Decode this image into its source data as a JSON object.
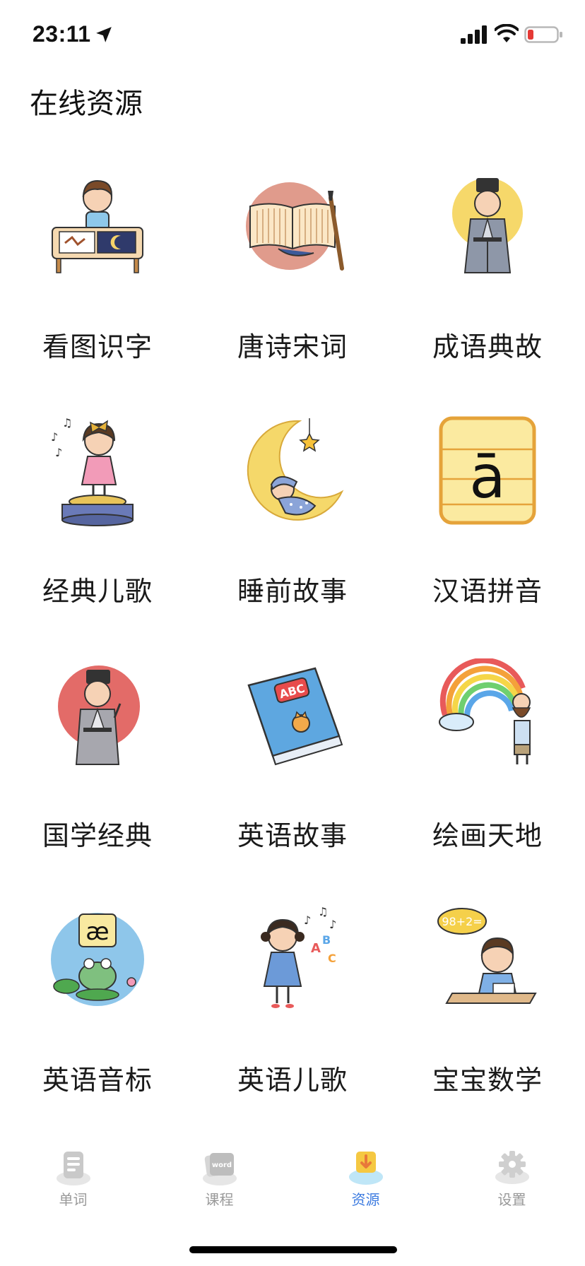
{
  "status_bar": {
    "time": "23:11",
    "icons": [
      "location-arrow-icon",
      "cellular-signal-icon",
      "wifi-icon",
      "battery-low-icon"
    ],
    "battery_color": "#e53935"
  },
  "page": {
    "title": "在线资源"
  },
  "resources": [
    {
      "label": "看图识字",
      "icon": "boy-writing-icon"
    },
    {
      "label": "唐诗宋词",
      "icon": "poetry-scroll-icon"
    },
    {
      "label": "成语典故",
      "icon": "scholar-icon"
    },
    {
      "label": "经典儿歌",
      "icon": "girl-singing-icon"
    },
    {
      "label": "睡前故事",
      "icon": "moon-baby-icon"
    },
    {
      "label": "汉语拼音",
      "icon": "pinyin-card-icon"
    },
    {
      "label": "国学经典",
      "icon": "confucian-scholar-icon"
    },
    {
      "label": "英语故事",
      "icon": "abc-book-icon"
    },
    {
      "label": "绘画天地",
      "icon": "rainbow-painter-icon"
    },
    {
      "label": "英语音标",
      "icon": "frog-phonetic-icon"
    },
    {
      "label": "英语儿歌",
      "icon": "girl-singing-abc-icon"
    },
    {
      "label": "宝宝数学",
      "icon": "boy-math-icon"
    }
  ],
  "pinyin_glyph": "ā",
  "phonetic_glyph": "æ",
  "book_text": "ABC",
  "math_text": "98+2=",
  "tab_bar": {
    "tabs": [
      {
        "label": "单词",
        "icon": "word-list-icon",
        "active": false
      },
      {
        "label": "课程",
        "icon": "word-cards-icon",
        "active": false,
        "icon_text": "word"
      },
      {
        "label": "资源",
        "icon": "cloud-download-icon",
        "active": true
      },
      {
        "label": "设置",
        "icon": "gear-icon",
        "active": false
      }
    ],
    "active_color": "#3b7ae0",
    "inactive_color": "#999999"
  }
}
